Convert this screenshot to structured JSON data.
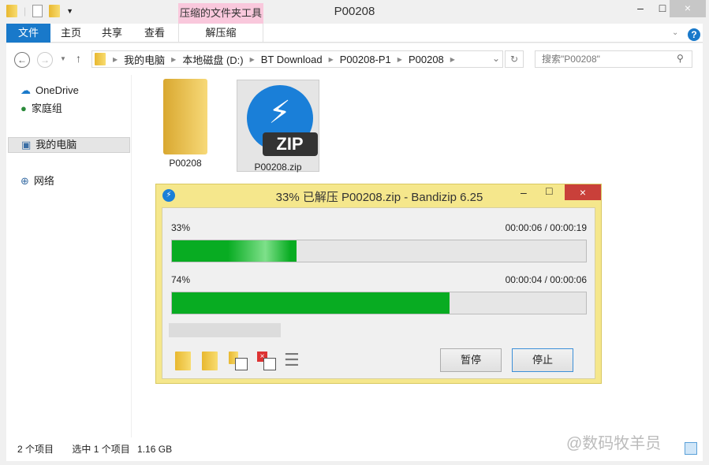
{
  "window": {
    "title": "P00208",
    "context_tab": "压缩的文件夹工具",
    "minimize": "–",
    "maximize": "□",
    "close": "×"
  },
  "ribbon": {
    "tabs": [
      "文件",
      "主页",
      "共享",
      "查看",
      "解压缩"
    ]
  },
  "address": {
    "crumbs": [
      "我的电脑",
      "本地磁盘 (D:)",
      "BT Download",
      "P00208-P1",
      "P00208"
    ],
    "search_placeholder": "搜索\"P00208\""
  },
  "nav": {
    "items": [
      "OneDrive",
      "家庭组",
      "我的电脑",
      "网络"
    ]
  },
  "files": [
    {
      "name": "P00208",
      "icon": "folder-icon"
    },
    {
      "name": "P00208.zip",
      "icon": "bandizip-zip-icon",
      "badge": "ZIP"
    }
  ],
  "status": {
    "count": "2 个项目",
    "selected": "选中 1 个项目",
    "size": "1.16 GB"
  },
  "watermark": "@数码牧羊员",
  "dialog": {
    "title": "33% 已解压 P00208.zip - Bandizip 6.25",
    "progress": [
      {
        "label": "33%",
        "time": "00:00:06 / 00:00:19",
        "fill_percent": 30,
        "color": "#08ac22"
      },
      {
        "label": "74%",
        "time": "00:00:04 / 00:00:06",
        "fill_percent": 67,
        "color": "#08ac22"
      }
    ],
    "pause": "暂停",
    "stop": "停止",
    "close": "×"
  }
}
